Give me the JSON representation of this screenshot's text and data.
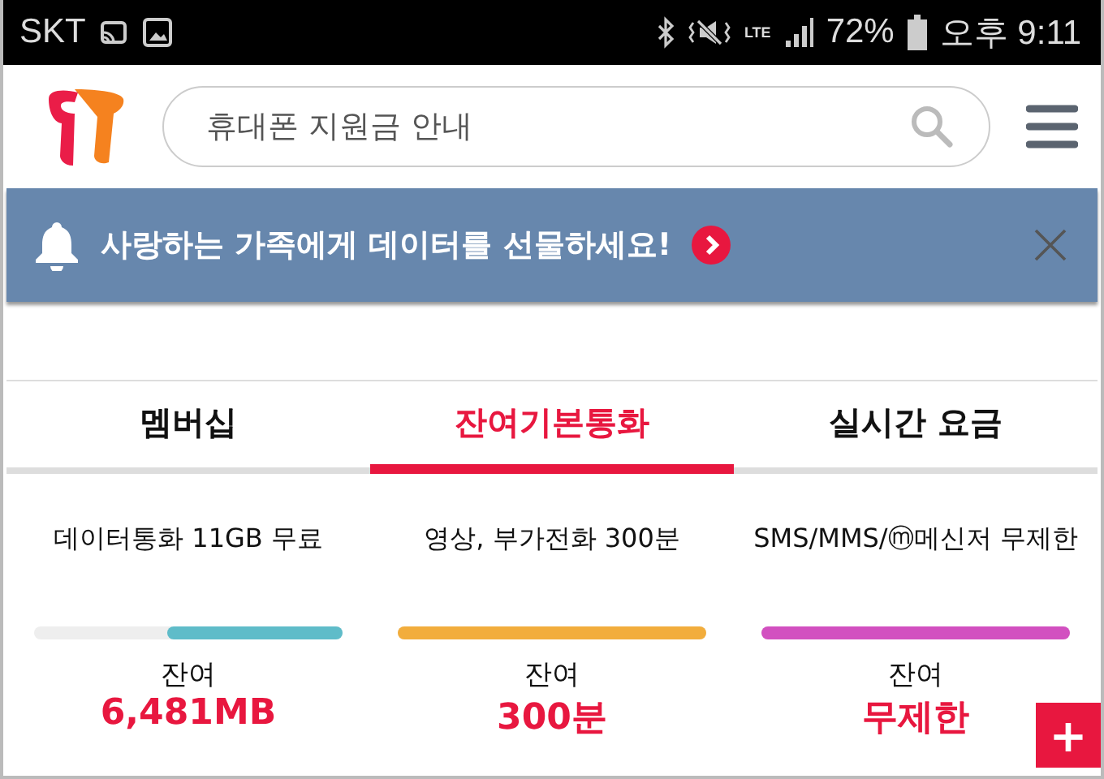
{
  "status_bar": {
    "carrier": "SKT",
    "network": "LTE",
    "battery": "72%",
    "time": "오후 9:11"
  },
  "header": {
    "search": {
      "placeholder": "휴대폰 지원금 안내"
    }
  },
  "banner": {
    "text": "사랑하는 가족에게 데이터를 선물하세요!"
  },
  "tabs": [
    {
      "label": "멤버십",
      "selected": false
    },
    {
      "label": "잔여기본통화",
      "selected": true
    },
    {
      "label": "실시간 요금",
      "selected": false
    }
  ],
  "plans": [
    {
      "title": "데이터통화 11GB 무료",
      "label": "잔여",
      "remaining": "6,481MB",
      "level": 0.57,
      "color": "#5fbcc9"
    },
    {
      "title": "영상, 부가전화 300분",
      "label": "잔여",
      "remaining": "300분",
      "level": 1,
      "color": "#f2ad3c"
    },
    {
      "title": "SMS/MMS/ⓜ메신저 무제한",
      "label": "잔여",
      "remaining": "무제한",
      "level": 1,
      "color": "#d250c0"
    }
  ],
  "fab": {
    "label": "+"
  }
}
